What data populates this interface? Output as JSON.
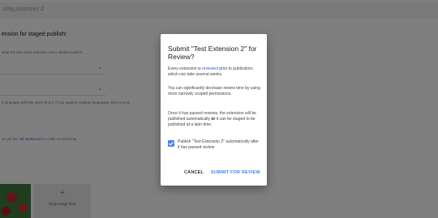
{
  "background": {
    "top_field_text": "ding purposes 2",
    "heading": "ension for staged publish!",
    "hint_description": "what the item does and who users should install it.",
    "select_chevron": "⌄",
    "hint_languages": "h language will help users find it. If you support multiple languages, then you sh",
    "hint_screenshots_prefix": "or use the",
    "hint_screenshots_link": "old dashboard",
    "hint_screenshots_suffix": "to order screenshots.",
    "drop_plus": "+",
    "drop_label": "Drop image here"
  },
  "dialog": {
    "title": "Submit \"Test Extension 2\" for Review?",
    "p1_before": "Every extension is",
    "p1_link": "reviewed",
    "p1_after": "prior to publication, which can take several weeks.",
    "p2": "You can significantly decrease review time by using more narrowly scoped permissions.",
    "p3_before": "Once it has passed reviews, the extension will be published automatically",
    "p3_bold": "or",
    "p3_after": "it can be staged to be published at a later time.",
    "checkbox_label": "Publish \"Test Extension 2\" automatically after it has passed review",
    "checkbox_checked": true,
    "cancel_label": "CANCEL",
    "submit_label": "SUBMIT FOR REVIEW"
  },
  "colors": {
    "accent": "#4285f4",
    "link": "#3367d6",
    "overlay": "rgba(0,0,0,0.5)"
  }
}
